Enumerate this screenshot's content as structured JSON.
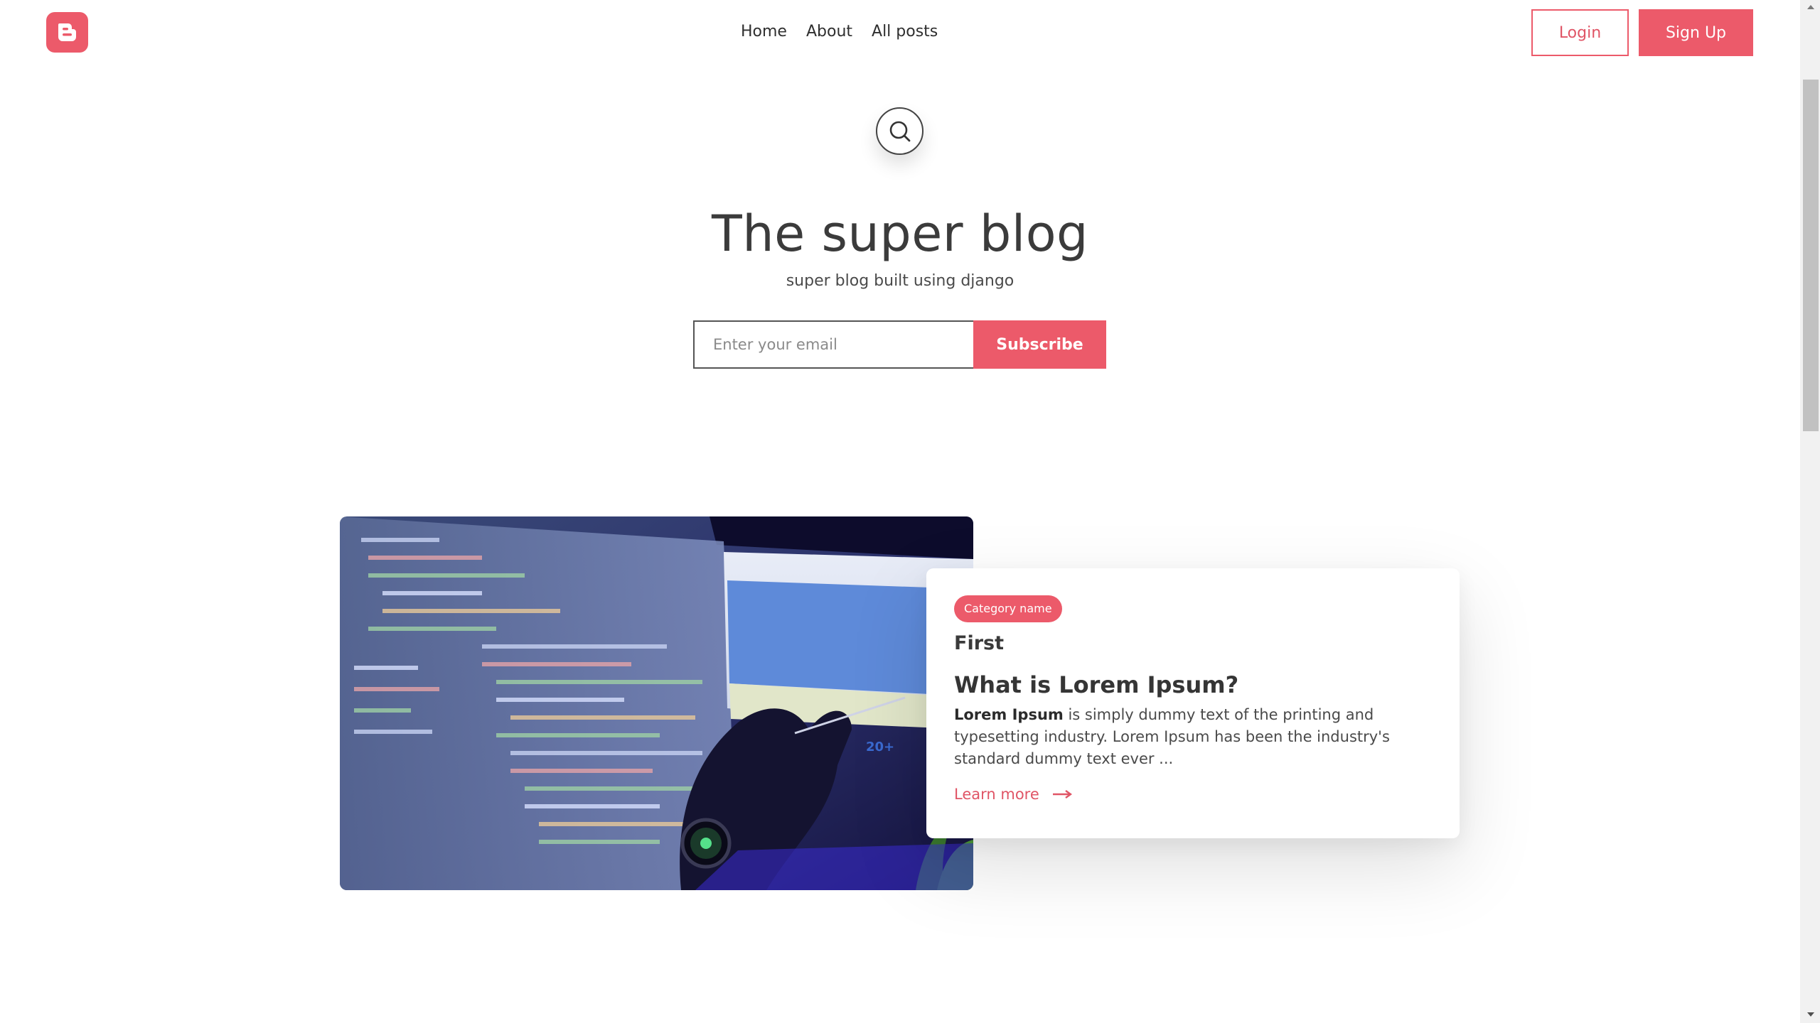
{
  "header": {
    "logo_icon": "blogger-logo-icon",
    "nav": [
      "Home",
      "About",
      "All posts"
    ],
    "login_label": "Login",
    "signup_label": "Sign Up"
  },
  "hero": {
    "search_icon": "search-icon",
    "title": "The super blog",
    "subtitle": "super blog built using django",
    "email_placeholder": "Enter your email",
    "email_value": "",
    "subscribe_label": "Subscribe"
  },
  "post": {
    "image": "code-on-monitor-photo",
    "category": "Category name",
    "label": "First",
    "title": "What is Lorem Ipsum?",
    "excerpt_bold": "Lorem Ipsum",
    "excerpt_rest": " is simply dummy text of the printing and typesetting industry. Lorem Ipsum has been the industry's standard dummy text ever ...",
    "learn_more": "Learn more",
    "arrow_icon": "arrow-right-icon"
  },
  "colors": {
    "accent": "#ec5a6a",
    "text": "#3a3a3a"
  }
}
